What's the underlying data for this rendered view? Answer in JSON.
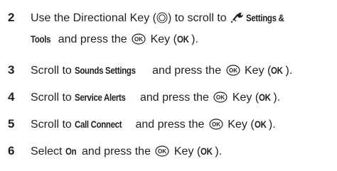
{
  "steps": [
    {
      "number": "2",
      "line1_pre": "Use the Directional Key (",
      "line1_post": ") to scroll to ",
      "line1_kw": "Settings &",
      "line2_kw": "Tools",
      "line2_post_a": " and press the ",
      "line2_post_b": " Key (",
      "line2_kw_ok": "OK",
      "line2_end": ")."
    },
    {
      "number": "3",
      "pre": "Scroll to ",
      "kw": "Sounds Settings",
      "mid": " and press the ",
      "post": " Key (",
      "kw_ok": "OK",
      "end": ")."
    },
    {
      "number": "4",
      "pre": "Scroll to ",
      "kw": "Service Alerts",
      "mid": " and press the ",
      "post": " Key (",
      "kw_ok": "OK",
      "end": ")."
    },
    {
      "number": "5",
      "pre": "Scroll to ",
      "kw": "Call Connect",
      "mid": " and press the ",
      "post": " Key (",
      "kw_ok": "OK",
      "end": ")."
    },
    {
      "number": "6",
      "pre": "Select ",
      "kw": "On",
      "mid": " and press the ",
      "post": " Key (",
      "kw_ok": "OK",
      "end": ")."
    }
  ],
  "icons": {
    "directional": "directional-key-icon",
    "ok": "ok-key-icon",
    "tools": "settings-tools-icon"
  }
}
